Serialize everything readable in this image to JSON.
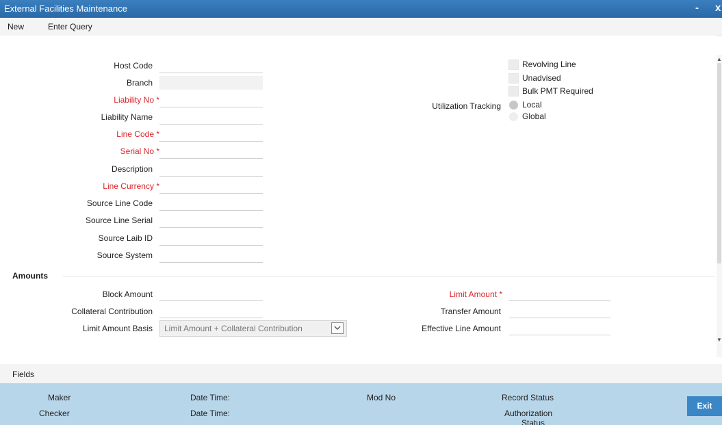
{
  "window": {
    "title": "External Facilities Maintenance",
    "minimize_label": "-",
    "close_label": "x"
  },
  "menu": {
    "new": "New",
    "enter_query": "Enter Query"
  },
  "form": {
    "host_code": {
      "label": "Host Code",
      "value": ""
    },
    "branch": {
      "label": "Branch",
      "value": ""
    },
    "liability_no": {
      "label": "Liability No *",
      "value": ""
    },
    "liability_name": {
      "label": "Liability Name",
      "value": ""
    },
    "line_code": {
      "label": "Line Code *",
      "value": ""
    },
    "serial_no": {
      "label": "Serial No *",
      "value": ""
    },
    "description": {
      "label": "Description",
      "value": ""
    },
    "line_currency": {
      "label": "Line Currency *",
      "value": ""
    },
    "source_line_code": {
      "label": "Source Line Code",
      "value": ""
    },
    "source_line_serial": {
      "label": "Source Line Serial",
      "value": ""
    },
    "source_laib_id": {
      "label": "Source Laib ID",
      "value": ""
    },
    "source_system": {
      "label": "Source System",
      "value": ""
    },
    "revolving_line": {
      "label": "Revolving Line",
      "checked": false
    },
    "unadvised": {
      "label": "Unadvised",
      "checked": false
    },
    "bulk_pmt_required": {
      "label": "Bulk PMT Required",
      "checked": false
    },
    "utilization_tracking": {
      "label": "Utilization Tracking",
      "options": [
        "Local",
        "Global"
      ],
      "selected": "Local"
    }
  },
  "amounts": {
    "section_title": "Amounts",
    "block_amount": {
      "label": "Block Amount",
      "value": ""
    },
    "collateral_contribution": {
      "label": "Collateral Contribution",
      "value": ""
    },
    "limit_amount_basis": {
      "label": "Limit Amount Basis",
      "value": "Limit Amount + Collateral Contribution"
    },
    "limit_amount": {
      "label": "Limit Amount *",
      "value": ""
    },
    "transfer_amount": {
      "label": "Transfer Amount",
      "value": ""
    },
    "effective_line_amount": {
      "label": "Effective Line Amount",
      "value": ""
    }
  },
  "fields_bar": {
    "label": "Fields"
  },
  "audit": {
    "maker": "Maker",
    "checker": "Checker",
    "date_time_1": "Date Time:",
    "date_time_2": "Date Time:",
    "mod_no": "Mod No",
    "record_status": "Record Status",
    "authorization_status_line1": "Authorization",
    "authorization_status_line2": "Status"
  },
  "buttons": {
    "exit": "Exit"
  },
  "colors": {
    "titlebar": "#2f73b2",
    "required_label": "#d9262c",
    "audit_bar": "#b8d6ea",
    "exit_button": "#3b86c6"
  },
  "icons": {
    "dropdown": "chevron-down-icon",
    "scroll_up": "arrow-up-icon",
    "scroll_down": "arrow-down-icon"
  }
}
